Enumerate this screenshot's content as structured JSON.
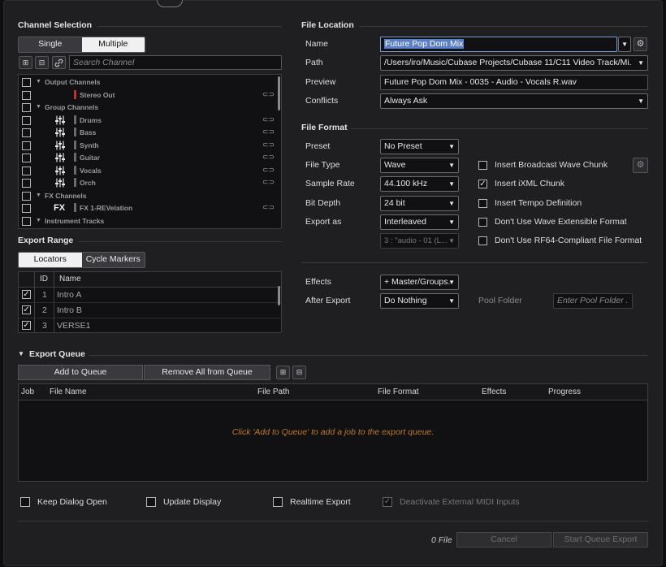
{
  "channel_selection": {
    "title": "Channel Selection",
    "mode_tabs": [
      "Single",
      "Multiple"
    ],
    "active_mode": "Multiple",
    "search_placeholder": "Search Channel",
    "channels": [
      {
        "type": "group",
        "label": "Output Channels"
      },
      {
        "type": "channel",
        "label": "Stereo Out",
        "icon": "none",
        "color": "#c0302c"
      },
      {
        "type": "group",
        "label": "Group Channels"
      },
      {
        "type": "channel",
        "label": "Drums",
        "icon": "mixer-fader-icon"
      },
      {
        "type": "channel",
        "label": "Bass",
        "icon": "mixer-fader-icon"
      },
      {
        "type": "channel",
        "label": "Synth",
        "icon": "mixer-fader-icon"
      },
      {
        "type": "channel",
        "label": "Guitar",
        "icon": "mixer-fader-icon"
      },
      {
        "type": "channel",
        "label": "Vocals",
        "icon": "mixer-fader-icon"
      },
      {
        "type": "channel",
        "label": "Orch",
        "icon": "mixer-fader-icon"
      },
      {
        "type": "group",
        "label": "FX Channels"
      },
      {
        "type": "channel",
        "label": "FX 1-REVelation",
        "icon": "FX"
      },
      {
        "type": "group",
        "label": "Instrument Tracks"
      }
    ]
  },
  "export_range": {
    "title": "Export Range",
    "tabs": [
      "Locators",
      "Cycle Markers"
    ],
    "active_tab": "Locators",
    "columns": [
      "ID",
      "Name"
    ],
    "rows": [
      {
        "checked": true,
        "id": "1",
        "name": "Intro A"
      },
      {
        "checked": true,
        "id": "2",
        "name": "Intro B"
      },
      {
        "checked": true,
        "id": "3",
        "name": "VERSE1"
      }
    ]
  },
  "file_location": {
    "title": "File Location",
    "name_label": "Name",
    "name_value": "Future Pop Dom Mix",
    "path_label": "Path",
    "path_value": "/Users/iro/Music/Cubase Projects/Cubase 11/C11 Video Track/Mi.",
    "preview_label": "Preview",
    "preview_value": "Future Pop Dom Mix - 0035 - Audio - Vocals R.wav",
    "conflicts_label": "Conflicts",
    "conflicts_value": "Always Ask"
  },
  "file_format": {
    "title": "File Format",
    "preset_label": "Preset",
    "preset_value": "No Preset",
    "file_type_label": "File Type",
    "file_type_value": "Wave",
    "sample_rate_label": "Sample Rate",
    "sample_rate_value": "44.100 kHz",
    "bit_depth_label": "Bit Depth",
    "bit_depth_value": "24 bit",
    "export_as_label": "Export as",
    "export_as_value": "Interleaved",
    "channels_value": "3 : \"audio - 01 (L...",
    "options": [
      {
        "label": "Insert Broadcast Wave Chunk",
        "checked": false
      },
      {
        "label": "Insert iXML Chunk",
        "checked": true
      },
      {
        "label": "Insert Tempo Definition",
        "checked": false
      },
      {
        "label": "Don't Use Wave Extensible Format",
        "checked": false
      },
      {
        "label": "Don't Use RF64-Compliant File Format",
        "checked": false
      }
    ]
  },
  "post": {
    "effects_label": "Effects",
    "effects_value": "+ Master/Groups.",
    "after_export_label": "After Export",
    "after_export_value": "Do Nothing",
    "pool_folder_label": "Pool Folder",
    "pool_folder_placeholder": "Enter Pool Folder ."
  },
  "queue": {
    "title": "Export Queue",
    "add_label": "Add to Queue",
    "remove_all_label": "Remove All from Queue",
    "columns": [
      "Job",
      "File Name",
      "File Path",
      "File Format",
      "Effects",
      "Progress"
    ],
    "empty_message": "Click 'Add to Queue' to add a job to the export queue."
  },
  "footer": {
    "keep_open": "Keep Dialog Open",
    "update_display": "Update Display",
    "realtime_export": "Realtime Export",
    "deactivate_midi": "Deactivate External MIDI Inputs",
    "file_count": "0 File",
    "cancel_label": "Cancel",
    "start_label": "Start Queue Export"
  },
  "colors": {
    "accent_highlight": "#5a7fc4",
    "empty_message": "#c07a2a",
    "stereo_out": "#c0302c"
  }
}
